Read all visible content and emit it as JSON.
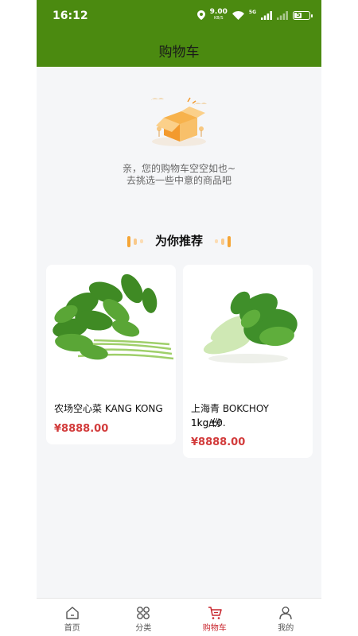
{
  "status_bar": {
    "time": "16:12",
    "net_speed": "9.00",
    "net_unit": "KB/S",
    "signal_label": "5G",
    "battery_level": "5"
  },
  "header": {
    "title": "购物车"
  },
  "empty_cart": {
    "line1": "亲，您的购物车空空如也~",
    "line2": "去挑选一些中意的商品吧"
  },
  "recommend": {
    "title": "为你推荐"
  },
  "products": [
    {
      "name": "农场空心菜 KANG KONG",
      "price": "¥8888.00"
    },
    {
      "name_line1": "上海青 BOKCHOY 1kg±0.",
      "name_line2": "1kg/份",
      "price": "¥8888.00"
    }
  ],
  "tabbar": {
    "items": [
      {
        "label": "首页",
        "icon": "home-icon"
      },
      {
        "label": "分类",
        "icon": "grid-icon"
      },
      {
        "label": "购物车",
        "icon": "cart-icon",
        "active": true
      },
      {
        "label": "我的",
        "icon": "user-icon"
      }
    ]
  },
  "colors": {
    "brand_green": "#4b8a10",
    "price_red": "#d23b3b",
    "active_tab": "#c8272f",
    "accent_orange": "#f5a536"
  }
}
